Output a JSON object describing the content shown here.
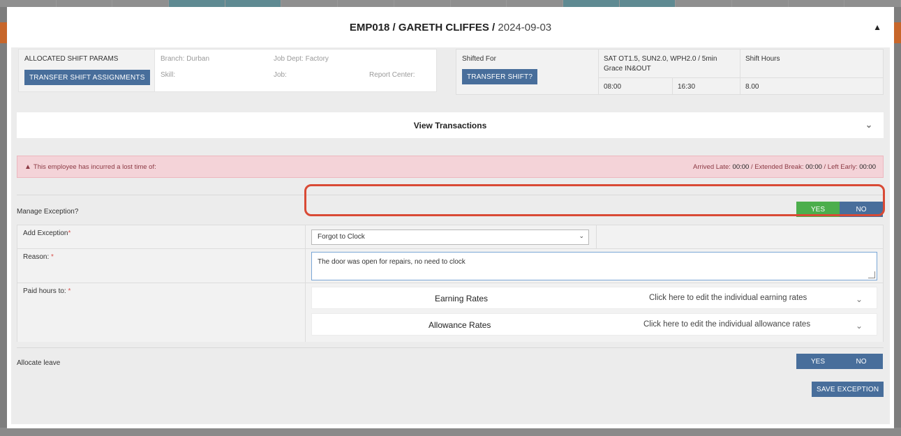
{
  "modal": {
    "title_id": "EMP018 / GARETH CLIFFES /",
    "title_date": "2024-09-03"
  },
  "params": {
    "allocated_label": "ALLOCATED SHIFT PARAMS",
    "transfer_assignments_label": "TRANSFER SHIFT ASSIGNMENTS",
    "branch": "Branch: Durban",
    "job_dept": "Job Dept: Factory",
    "skill": "Skill:",
    "job": "Job:",
    "report_center": "Report Center:",
    "shifted_for": "Shifted For",
    "transfer_shift_label": "TRANSFER SHIFT?",
    "shift_code_line1": "SAT OT1.5, SUN2.0, WPH2.0 / 5min",
    "shift_code_line2": "Grace IN&OUT",
    "shift_hours_label": "Shift Hours",
    "start_time": "08:00",
    "end_time": "16:30",
    "shift_hours": "8.00"
  },
  "view_transactions": "View Transactions",
  "alert": {
    "message": "This employee has incurred a lost time of:",
    "arrived_late_label": "Arrived Late: ",
    "arrived_late": "00:00",
    "extended_break_label": " / Extended Break: ",
    "extended_break": "00:00",
    "left_early_label": " / Left Early: ",
    "left_early": "00:00"
  },
  "manage_exception": {
    "label": "Manage Exception?",
    "yes": "YES",
    "no": "NO",
    "selected": "YES"
  },
  "form": {
    "add_exception_label": "Add Exception",
    "add_exception_value": "Forgot to Clock",
    "reason_label": "Reason: ",
    "reason_value": "The door was open for repairs, no need to clock",
    "paid_hours_label": "Paid hours to: ",
    "required_mark": "*"
  },
  "earning_rates": {
    "title": "Earning Rates",
    "hint": "Click here to edit the individual earning rates"
  },
  "allowance_rates": {
    "title": "Allowance Rates",
    "hint": "Click here to edit the individual allowance rates"
  },
  "allocate_leave": {
    "label": "Allocate leave",
    "yes": "YES",
    "no": "NO"
  },
  "save_exception": "SAVE EXCEPTION",
  "colors": {
    "primary_button": "#486e9b",
    "yes_active": "#4cae4c",
    "alert_bg": "#f4d3d8",
    "highlight": "#d94a35"
  },
  "icons": {
    "warning": "warning-icon",
    "chevron": "chevron-down-icon"
  }
}
